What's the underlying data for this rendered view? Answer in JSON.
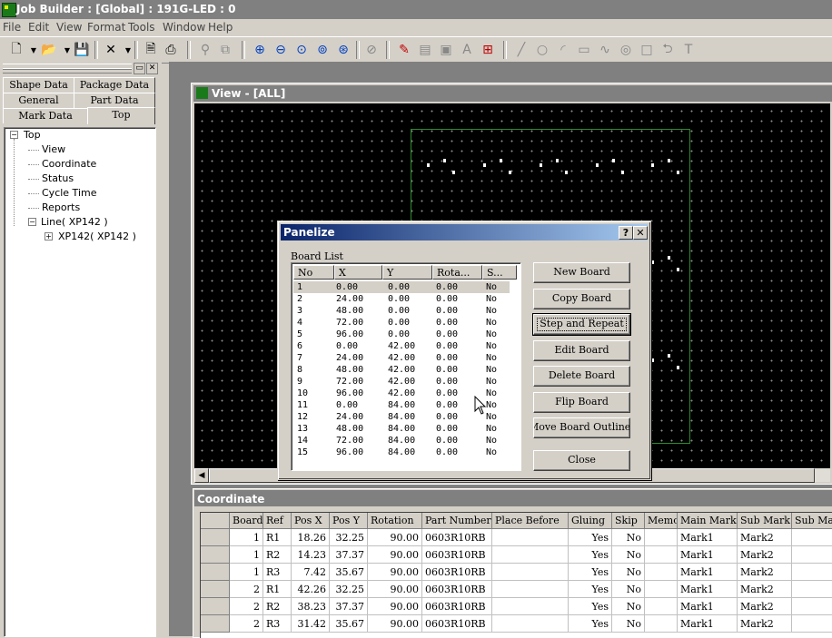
{
  "app": {
    "title": "Job Builder : [Global] : 191G-LED : 0"
  },
  "menu": [
    "File",
    "Edit",
    "View",
    "Format",
    "Tools",
    "Window",
    "Help"
  ],
  "toolbar_icons": [
    "new-file-icon",
    "open-folder-icon",
    "save-icon",
    "delete-icon",
    "print-preview-icon",
    "print-icon",
    "find-icon",
    "copy-icon",
    "zoom-in-icon",
    "zoom-out-icon",
    "zoom-fit-icon",
    "zoom-area-icon",
    "zoom-all-icon",
    "magnify-icon",
    "paint-icon",
    "grid-lines-icon",
    "image-icon",
    "text-style-icon",
    "crosshair-grid-icon",
    "line-icon",
    "circle-icon",
    "arc-icon",
    "rectangle-icon",
    "curve-icon",
    "polygon-icon",
    "square-icon",
    "rotate-icon",
    "text-icon"
  ],
  "left_panel": {
    "tabs_row1": [
      "Shape Data",
      "Package Data"
    ],
    "tabs_row2": [
      "General",
      "Part Data"
    ],
    "tabs_row3": [
      "Mark Data",
      "Top"
    ],
    "tree": {
      "root": "Top",
      "children": [
        "View",
        "Coordinate",
        "Status",
        "Cycle Time",
        "Reports"
      ],
      "line": "Line( XP142 )",
      "line_child": "XP142( XP142 )"
    }
  },
  "view_window": {
    "title": "View - [ALL]"
  },
  "coordinate_window": {
    "title": "Coordinate",
    "columns": [
      "Board",
      "Ref",
      "Pos X",
      "Pos Y",
      "Rotation",
      "Part Number",
      "Place Before",
      "Gluing",
      "Skip",
      "Memo",
      "Main Mark",
      "Sub Mark",
      "Sub Mar"
    ],
    "rows": [
      [
        "1",
        "R1",
        "18.26",
        "32.25",
        "90.00",
        "0603R10RB",
        "",
        "Yes",
        "No",
        "",
        "Mark1",
        "Mark2",
        ""
      ],
      [
        "1",
        "R2",
        "14.23",
        "37.37",
        "90.00",
        "0603R10RB",
        "",
        "Yes",
        "No",
        "",
        "Mark1",
        "Mark2",
        ""
      ],
      [
        "1",
        "R3",
        "7.42",
        "35.67",
        "90.00",
        "0603R10RB",
        "",
        "Yes",
        "No",
        "",
        "Mark1",
        "Mark2",
        ""
      ],
      [
        "2",
        "R1",
        "42.26",
        "32.25",
        "90.00",
        "0603R10RB",
        "",
        "Yes",
        "No",
        "",
        "Mark1",
        "Mark2",
        ""
      ],
      [
        "2",
        "R2",
        "38.23",
        "37.37",
        "90.00",
        "0603R10RB",
        "",
        "Yes",
        "No",
        "",
        "Mark1",
        "Mark2",
        ""
      ],
      [
        "2",
        "R3",
        "31.42",
        "35.67",
        "90.00",
        "0603R10RB",
        "",
        "Yes",
        "No",
        "",
        "Mark1",
        "Mark2",
        ""
      ]
    ]
  },
  "dialog": {
    "title": "Panelize",
    "help_btn": "?",
    "close_btn": "✕",
    "list_label": "Board List",
    "list_columns": [
      "No",
      "X",
      "Y",
      "Rota...",
      "S..."
    ],
    "boards": [
      [
        "1",
        "0.00",
        "0.00",
        "0.00",
        "No"
      ],
      [
        "2",
        "24.00",
        "0.00",
        "0.00",
        "No"
      ],
      [
        "3",
        "48.00",
        "0.00",
        "0.00",
        "No"
      ],
      [
        "4",
        "72.00",
        "0.00",
        "0.00",
        "No"
      ],
      [
        "5",
        "96.00",
        "0.00",
        "0.00",
        "No"
      ],
      [
        "6",
        "0.00",
        "42.00",
        "0.00",
        "No"
      ],
      [
        "7",
        "24.00",
        "42.00",
        "0.00",
        "No"
      ],
      [
        "8",
        "48.00",
        "42.00",
        "0.00",
        "No"
      ],
      [
        "9",
        "72.00",
        "42.00",
        "0.00",
        "No"
      ],
      [
        "10",
        "96.00",
        "42.00",
        "0.00",
        "No"
      ],
      [
        "11",
        "0.00",
        "84.00",
        "0.00",
        "No"
      ],
      [
        "12",
        "24.00",
        "84.00",
        "0.00",
        "No"
      ],
      [
        "13",
        "48.00",
        "84.00",
        "0.00",
        "No"
      ],
      [
        "14",
        "72.00",
        "84.00",
        "0.00",
        "No"
      ],
      [
        "15",
        "96.00",
        "84.00",
        "0.00",
        "No"
      ]
    ],
    "buttons": {
      "new_board": "New Board",
      "copy_board": "Copy Board",
      "step_repeat": "Step and Repeat",
      "edit_board": "Edit Board",
      "delete_board": "Delete Board",
      "flip_board": "Flip Board",
      "move_outline": "Move Board Outline",
      "close": "Close"
    }
  }
}
